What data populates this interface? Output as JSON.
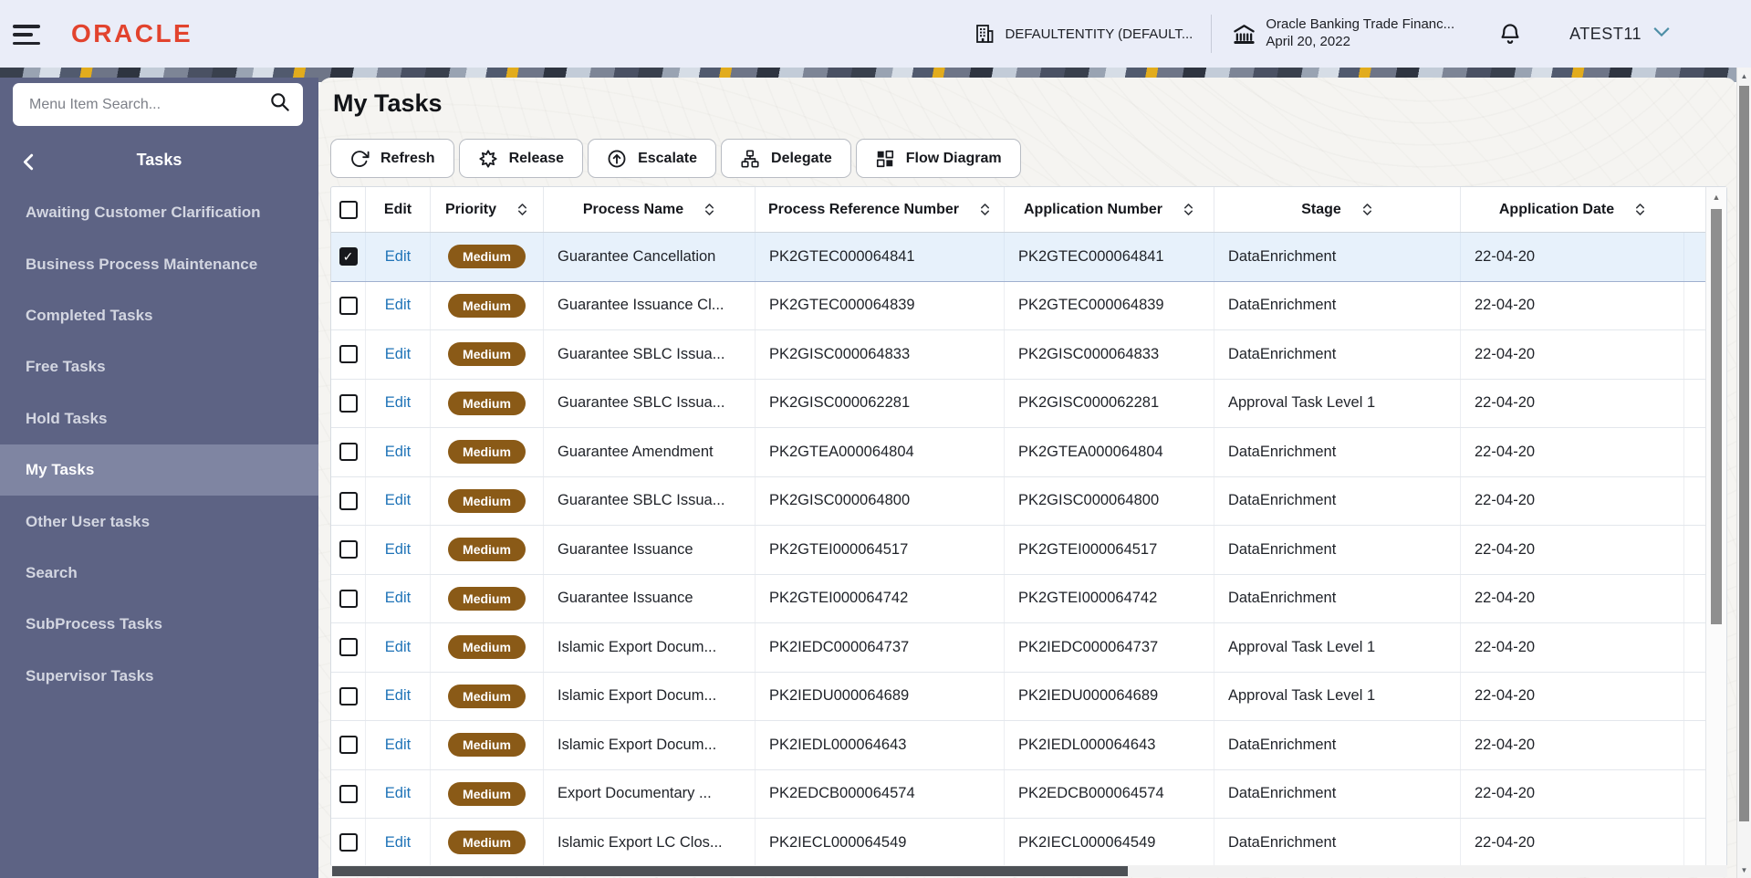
{
  "header": {
    "logo": "ORACLE",
    "entity": "DEFAULTENTITY (DEFAULT...",
    "bank_name": "Oracle Banking Trade Financ...",
    "bank_date": "April 20, 2022",
    "user": "ATEST11"
  },
  "sidebar": {
    "search_placeholder": "Menu Item Search...",
    "section_title": "Tasks",
    "items": [
      {
        "label": "Awaiting Customer Clarification",
        "selected": false
      },
      {
        "label": "Business Process Maintenance",
        "selected": false
      },
      {
        "label": "Completed Tasks",
        "selected": false
      },
      {
        "label": "Free Tasks",
        "selected": false
      },
      {
        "label": "Hold Tasks",
        "selected": false
      },
      {
        "label": "My Tasks",
        "selected": true
      },
      {
        "label": "Other User tasks",
        "selected": false
      },
      {
        "label": "Search",
        "selected": false
      },
      {
        "label": "SubProcess Tasks",
        "selected": false
      },
      {
        "label": "Supervisor Tasks",
        "selected": false
      }
    ]
  },
  "main": {
    "title": "My Tasks",
    "toolbar": [
      {
        "label": "Refresh",
        "icon": "refresh-icon"
      },
      {
        "label": "Release",
        "icon": "release-icon"
      },
      {
        "label": "Escalate",
        "icon": "escalate-icon"
      },
      {
        "label": "Delegate",
        "icon": "delegate-icon"
      },
      {
        "label": "Flow Diagram",
        "icon": "flow-diagram-icon"
      }
    ],
    "table": {
      "columns": [
        {
          "label": "Edit",
          "sortable": false
        },
        {
          "label": "Priority",
          "sortable": true
        },
        {
          "label": "Process Name",
          "sortable": true
        },
        {
          "label": "Process Reference Number",
          "sortable": true
        },
        {
          "label": "Application Number",
          "sortable": true
        },
        {
          "label": "Stage",
          "sortable": true
        },
        {
          "label": "Application Date",
          "sortable": true
        }
      ],
      "rows": [
        {
          "selected": true,
          "edit": "Edit",
          "priority": "Medium",
          "process_name": "Guarantee Cancellation",
          "process_reference_number": "PK2GTEC000064841",
          "application_number": "PK2GTEC000064841",
          "stage": "DataEnrichment",
          "application_date": "22-04-20"
        },
        {
          "selected": false,
          "edit": "Edit",
          "priority": "Medium",
          "process_name": "Guarantee Issuance Cl...",
          "process_reference_number": "PK2GTEC000064839",
          "application_number": "PK2GTEC000064839",
          "stage": "DataEnrichment",
          "application_date": "22-04-20"
        },
        {
          "selected": false,
          "edit": "Edit",
          "priority": "Medium",
          "process_name": "Guarantee SBLC Issua...",
          "process_reference_number": "PK2GISC000064833",
          "application_number": "PK2GISC000064833",
          "stage": "DataEnrichment",
          "application_date": "22-04-20"
        },
        {
          "selected": false,
          "edit": "Edit",
          "priority": "Medium",
          "process_name": "Guarantee SBLC Issua...",
          "process_reference_number": "PK2GISC000062281",
          "application_number": "PK2GISC000062281",
          "stage": "Approval Task Level 1",
          "application_date": "22-04-20"
        },
        {
          "selected": false,
          "edit": "Edit",
          "priority": "Medium",
          "process_name": "Guarantee Amendment",
          "process_reference_number": "PK2GTEA000064804",
          "application_number": "PK2GTEA000064804",
          "stage": "DataEnrichment",
          "application_date": "22-04-20"
        },
        {
          "selected": false,
          "edit": "Edit",
          "priority": "Medium",
          "process_name": "Guarantee SBLC Issua...",
          "process_reference_number": "PK2GISC000064800",
          "application_number": "PK2GISC000064800",
          "stage": "DataEnrichment",
          "application_date": "22-04-20"
        },
        {
          "selected": false,
          "edit": "Edit",
          "priority": "Medium",
          "process_name": "Guarantee Issuance",
          "process_reference_number": "PK2GTEI000064517",
          "application_number": "PK2GTEI000064517",
          "stage": "DataEnrichment",
          "application_date": "22-04-20"
        },
        {
          "selected": false,
          "edit": "Edit",
          "priority": "Medium",
          "process_name": "Guarantee Issuance",
          "process_reference_number": "PK2GTEI000064742",
          "application_number": "PK2GTEI000064742",
          "stage": "DataEnrichment",
          "application_date": "22-04-20"
        },
        {
          "selected": false,
          "edit": "Edit",
          "priority": "Medium",
          "process_name": "Islamic Export Docum...",
          "process_reference_number": "PK2IEDC000064737",
          "application_number": "PK2IEDC000064737",
          "stage": "Approval Task Level 1",
          "application_date": "22-04-20"
        },
        {
          "selected": false,
          "edit": "Edit",
          "priority": "Medium",
          "process_name": "Islamic Export Docum...",
          "process_reference_number": "PK2IEDU000064689",
          "application_number": "PK2IEDU000064689",
          "stage": "Approval Task Level 1",
          "application_date": "22-04-20"
        },
        {
          "selected": false,
          "edit": "Edit",
          "priority": "Medium",
          "process_name": "Islamic Export Docum...",
          "process_reference_number": "PK2IEDL000064643",
          "application_number": "PK2IEDL000064643",
          "stage": "DataEnrichment",
          "application_date": "22-04-20"
        },
        {
          "selected": false,
          "edit": "Edit",
          "priority": "Medium",
          "process_name": "Export Documentary ...",
          "process_reference_number": "PK2EDCB000064574",
          "application_number": "PK2EDCB000064574",
          "stage": "DataEnrichment",
          "application_date": "22-04-20"
        },
        {
          "selected": false,
          "edit": "Edit",
          "priority": "Medium",
          "process_name": "Islamic Export LC Clos...",
          "process_reference_number": "PK2IECL000064549",
          "application_number": "PK2IECL000064549",
          "stage": "DataEnrichment",
          "application_date": "22-04-20"
        }
      ]
    }
  },
  "colors": {
    "accent-red": "#e2432e",
    "header-bg": "#eaedf8",
    "sidebar-bg": "#5d6384",
    "sidebar-selected": "#7f85a2",
    "badge-bg": "#8a5a17",
    "selected-row": "#e7f1fb",
    "link-blue": "#1f73b7"
  }
}
